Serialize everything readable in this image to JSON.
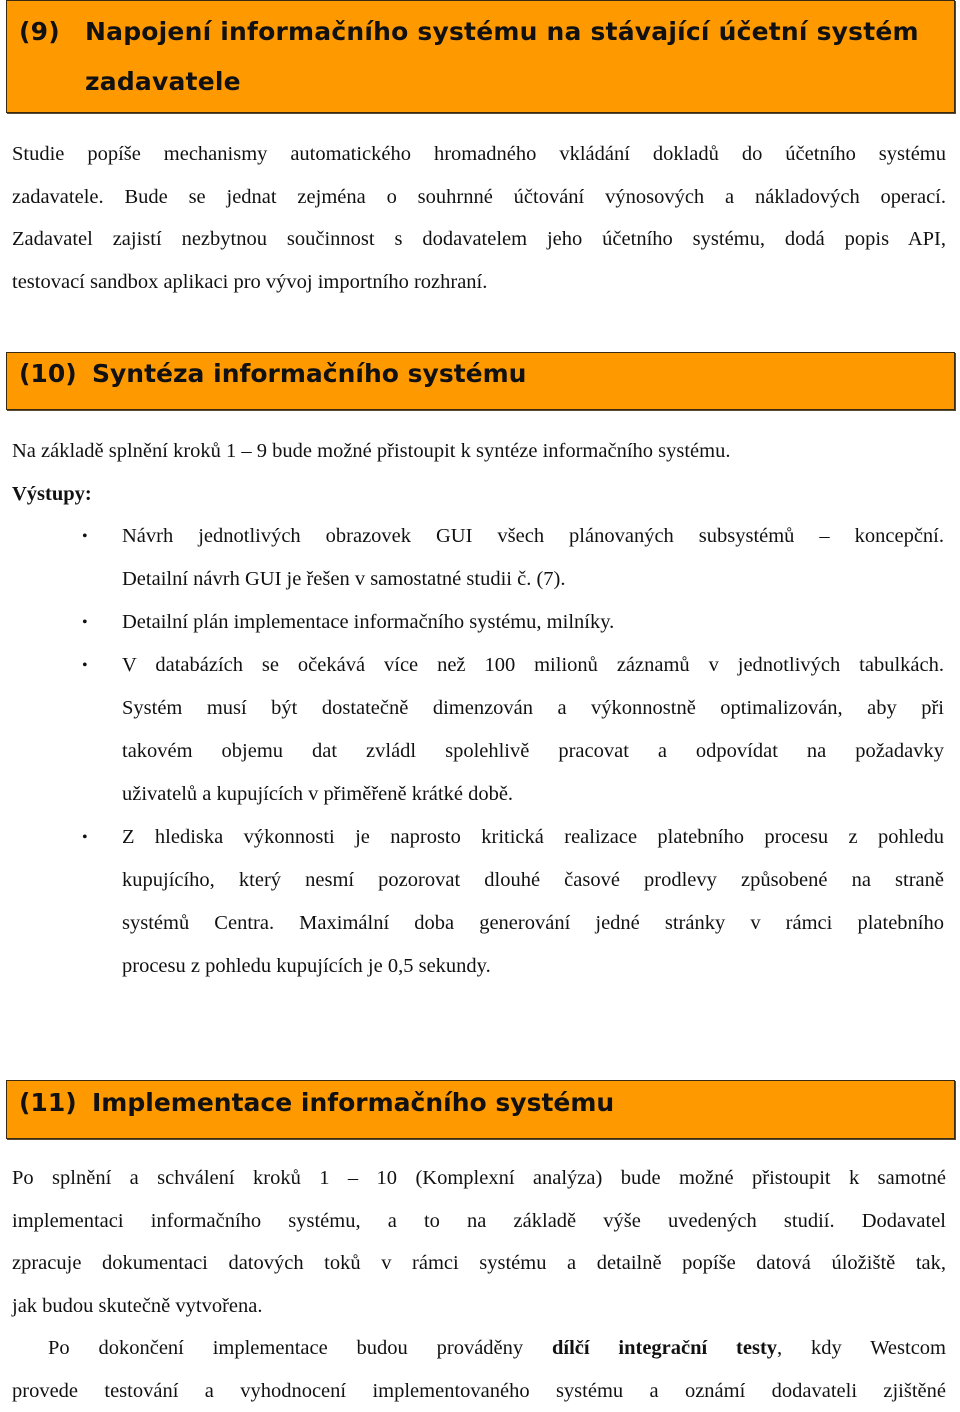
{
  "sections": [
    {
      "number": "(9)",
      "title_line1": "Napojení informačního systému na stávající účetní systém",
      "title_line2": "zadavatele",
      "paragraph_lines": [
        "Studie popíše mechanismy automatického hromadného vkládání dokladů do účetního systému",
        "zadavatele. Bude se jednat zejména o souhrnné účtování výnosových a nákladových operací.",
        "Zadavatel zajistí nezbytnou součinnost s dodavatelem jeho účetního systému, dodá popis API,",
        "testovací sandbox aplikaci pro vývoj importního rozhraní."
      ]
    },
    {
      "number": "(10)",
      "title": "Syntéza informačního systému",
      "intro": "Na základě splnění kroků 1 – 9  bude možné přistoupit k syntéze informačního systému.",
      "outputs_label": "Výstupy:",
      "bullet_glyph": "•",
      "bullets": [
        {
          "lines": [
            "Návrh jednotlivých obrazovek GUI všech plánovaných subsystémů – koncepční.",
            "Detailní návrh GUI je řešen v samostatné studii č. (7)."
          ]
        },
        {
          "lines": [
            "Detailní plán implementace informačního systému, milníky."
          ]
        },
        {
          "lines": [
            "V databázích se očekává více než 100 milionů záznamů v jednotlivých tabulkách.",
            "Systém musí být dostatečně dimenzován a výkonnostně optimalizován, aby při",
            "takovém objemu dat zvládl spolehlivě pracovat a odpovídat na požadavky",
            "uživatelů a kupujících v přiměřeně krátké době."
          ]
        },
        {
          "lines": [
            "Z hlediska výkonnosti je naprosto kritická realizace platebního procesu z pohledu",
            "kupujícího, který nesmí pozorovat dlouhé časové prodlevy způsobené na straně",
            "systémů Centra. Maximální doba generování jedné stránky v rámci platebního",
            "procesu z pohledu kupujících je 0,5 sekundy."
          ]
        }
      ]
    },
    {
      "number": "(11)",
      "title": "Implementace informačního systému",
      "paragraph1_lines": [
        "Po splnění a schválení kroků 1 – 10 (Komplexní analýza) bude možné přistoupit k samotné",
        "implementaci informačního systému, a to na základě výše uvedených studií. Dodavatel",
        "zpracuje dokumentaci datových toků v rámci systému a detailně popíše datová úložiště tak,",
        "jak budou skutečně vytvořena."
      ],
      "paragraph2": {
        "line1_before": "Po dokončení implementace budou prováděny ",
        "line1_bold": "dílčí integrační testy",
        "line1_after": ", kdy Westcom",
        "line2": "provede testování a vyhodnocení implementovaného systému a oznámí dodavateli zjištěné"
      }
    }
  ],
  "colors": {
    "heading_background": "#ff9900",
    "heading_border": "#3a2a10",
    "text": "#111111"
  }
}
